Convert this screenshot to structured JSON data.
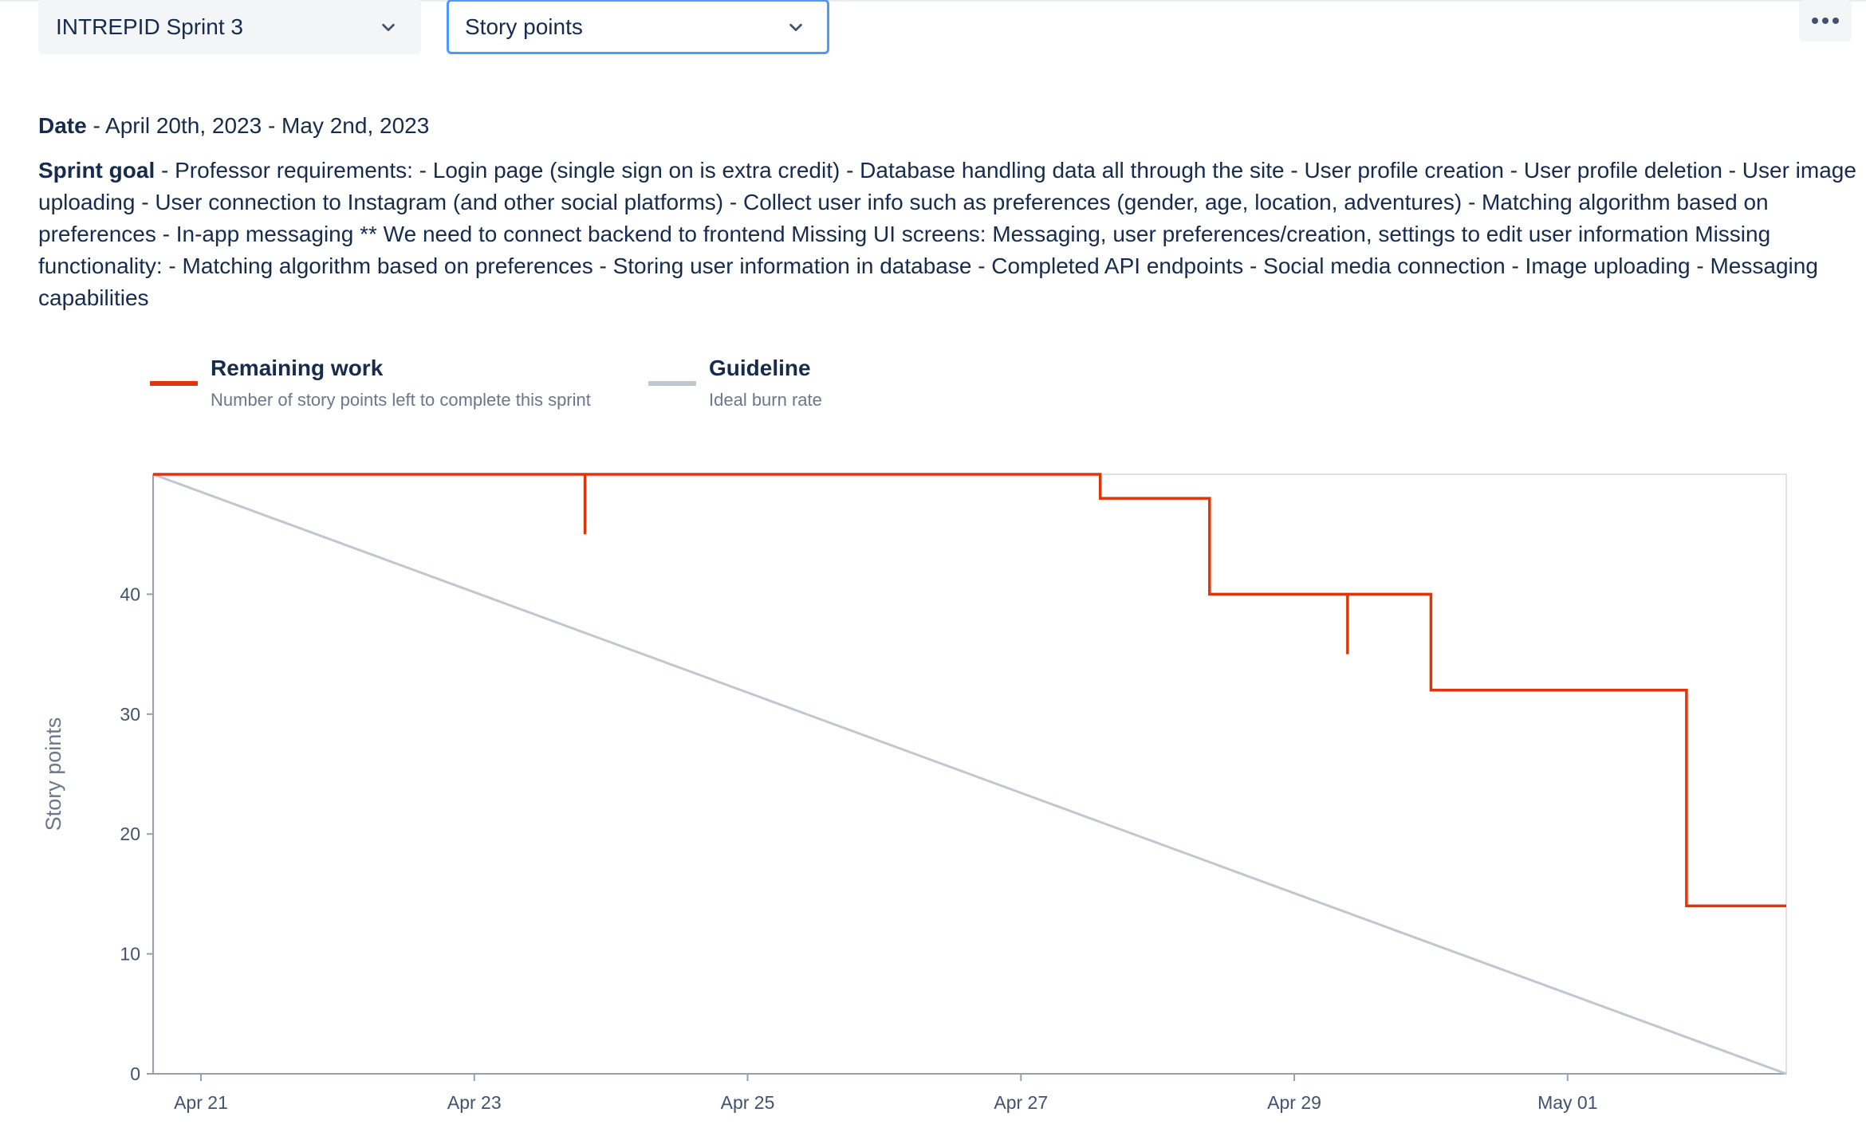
{
  "filters": {
    "sprint_select": "INTREPID Sprint 3",
    "estimation_select": "Story points"
  },
  "more_actions_icon": "more-horizontal-icon",
  "sprint_info": {
    "date_label": "Date",
    "date_value": " - April 20th, 2023 - May 2nd, 2023",
    "goal_label": "Sprint goal",
    "goal_value": " - Professor requirements: - Login page (single sign on is extra credit) - Database handling data all through the site - User profile creation - User profile deletion - User image uploading - User connection to Instagram (and other social platforms) - Collect user info such as preferences (gender, age, location, adventures) - Matching algorithm based on preferences - In-app messaging ** We need to connect backend to frontend Missing UI screens: Messaging, user preferences/creation, settings to edit user information Missing functionality: - Matching algorithm based on preferences - Storing user information in database - Completed API endpoints - Social media connection - Image uploading - Messaging capabilities"
  },
  "legend": [
    {
      "title": "Remaining work",
      "desc": "Number of story points left to complete this sprint",
      "color": "#de350b"
    },
    {
      "title": "Guideline",
      "desc": "Ideal burn rate",
      "color": "#c1c7d0"
    }
  ],
  "chart_data": {
    "type": "line",
    "ylabel": "Story points",
    "xlabel": "",
    "x_ticks": [
      "Apr 21",
      "Apr 23",
      "Apr 25",
      "Apr 27",
      "Apr 29",
      "May 01"
    ],
    "x_tick_days": [
      1,
      3,
      5,
      7,
      9,
      11
    ],
    "y_ticks": [
      0,
      10,
      20,
      30,
      40
    ],
    "ylim": [
      0,
      50
    ],
    "x_range_days": [
      0.65,
      12.6
    ],
    "grid": false,
    "series": [
      {
        "name": "Remaining work",
        "color": "#de350b",
        "step_points": [
          [
            0.65,
            50
          ],
          [
            7.58,
            50
          ],
          [
            7.58,
            48
          ],
          [
            8.38,
            48
          ],
          [
            8.38,
            40
          ],
          [
            10.0,
            40
          ],
          [
            10.0,
            32
          ],
          [
            11.87,
            32
          ],
          [
            11.87,
            14
          ],
          [
            12.6,
            14
          ]
        ],
        "spikes": [
          {
            "x": 3.81,
            "from": 50,
            "to": 45
          },
          {
            "x": 9.39,
            "from": 40,
            "to": 35
          }
        ]
      },
      {
        "name": "Guideline",
        "color": "#c1c7d0",
        "points": [
          [
            0.65,
            50
          ],
          [
            12.6,
            0
          ]
        ]
      }
    ]
  }
}
